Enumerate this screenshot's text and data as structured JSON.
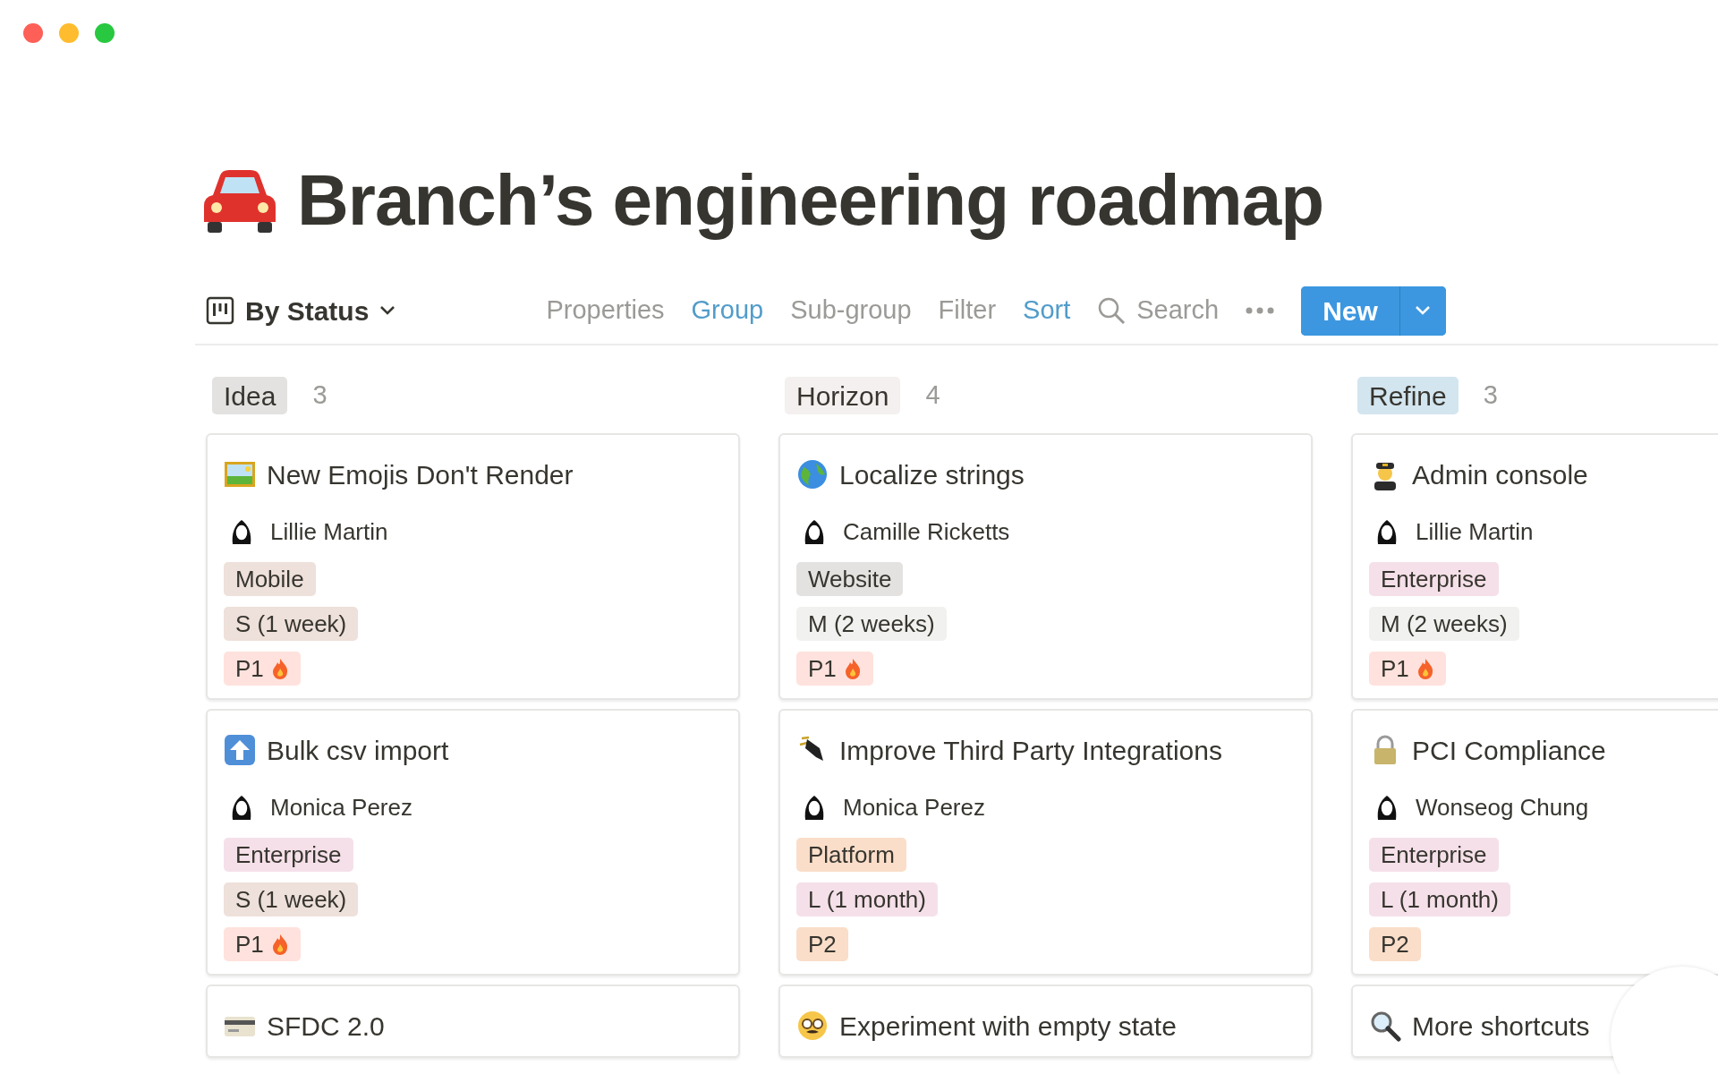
{
  "page": {
    "title": "Branch’s engineering roadmap"
  },
  "toolbar": {
    "view": "By Status",
    "actions": [
      {
        "label": "Properties",
        "active": false
      },
      {
        "label": "Group",
        "active": true
      },
      {
        "label": "Sub-group",
        "active": false
      },
      {
        "label": "Filter",
        "active": false
      },
      {
        "label": "Sort",
        "active": true
      }
    ],
    "search": "Search",
    "new_button": "New"
  },
  "columns": [
    {
      "label": "Idea",
      "color": "#e3e2e0",
      "count": "3",
      "cards": [
        {
          "title": "New Emojis Don't Render",
          "person": "Lillie Martin",
          "tags": [
            {
              "label": "Mobile",
              "color": "#eee0da",
              "flame": false
            },
            {
              "label": "S (1 week)",
              "color": "#eee0da",
              "flame": false
            },
            {
              "label": "P1",
              "color": "#ffe2dd",
              "flame": true
            }
          ]
        },
        {
          "title": "Bulk csv import",
          "person": "Monica Perez",
          "tags": [
            {
              "label": "Enterprise",
              "color": "#f5e0e9",
              "flame": false
            },
            {
              "label": "S (1 week)",
              "color": "#eee0da",
              "flame": false
            },
            {
              "label": "P1",
              "color": "#ffe2dd",
              "flame": true
            }
          ]
        },
        {
          "title": "SFDC 2.0"
        }
      ]
    },
    {
      "label": "Horizon",
      "color": "#f4f0ef",
      "count": "4",
      "cards": [
        {
          "title": "Localize strings",
          "person": "Camille Ricketts",
          "tags": [
            {
              "label": "Website",
              "color": "#e3e2e0",
              "flame": false
            },
            {
              "label": "M (2 weeks)",
              "color": "#f1f1ef",
              "flame": false
            },
            {
              "label": "P1",
              "color": "#ffe2dd",
              "flame": true
            }
          ]
        },
        {
          "title": "Improve Third Party Integrations",
          "person": "Monica Perez",
          "tags": [
            {
              "label": "Platform",
              "color": "#fadec9",
              "flame": false
            },
            {
              "label": "L (1 month)",
              "color": "#f5e0e9",
              "flame": false
            },
            {
              "label": "P2",
              "color": "#fadec9",
              "flame": false
            }
          ]
        },
        {
          "title": "Experiment with empty state"
        }
      ]
    },
    {
      "label": "Refine",
      "color": "#d3e5ef",
      "count": "3",
      "cards": [
        {
          "title": "Admin console",
          "person": "Lillie Martin",
          "tags": [
            {
              "label": "Enterprise",
              "color": "#f5e0e9",
              "flame": false
            },
            {
              "label": "M (2 weeks)",
              "color": "#f1f1ef",
              "flame": false
            },
            {
              "label": "P1",
              "color": "#ffe2dd",
              "flame": true
            }
          ]
        },
        {
          "title": "PCI Compliance",
          "person": "Wonseog Chung",
          "tags": [
            {
              "label": "Enterprise",
              "color": "#f5e0e9",
              "flame": false
            },
            {
              "label": "L (1 month)",
              "color": "#f5e0e9",
              "flame": false
            },
            {
              "label": "P2",
              "color": "#fadec9",
              "flame": false
            }
          ]
        },
        {
          "title": "More shortcuts"
        }
      ]
    }
  ]
}
